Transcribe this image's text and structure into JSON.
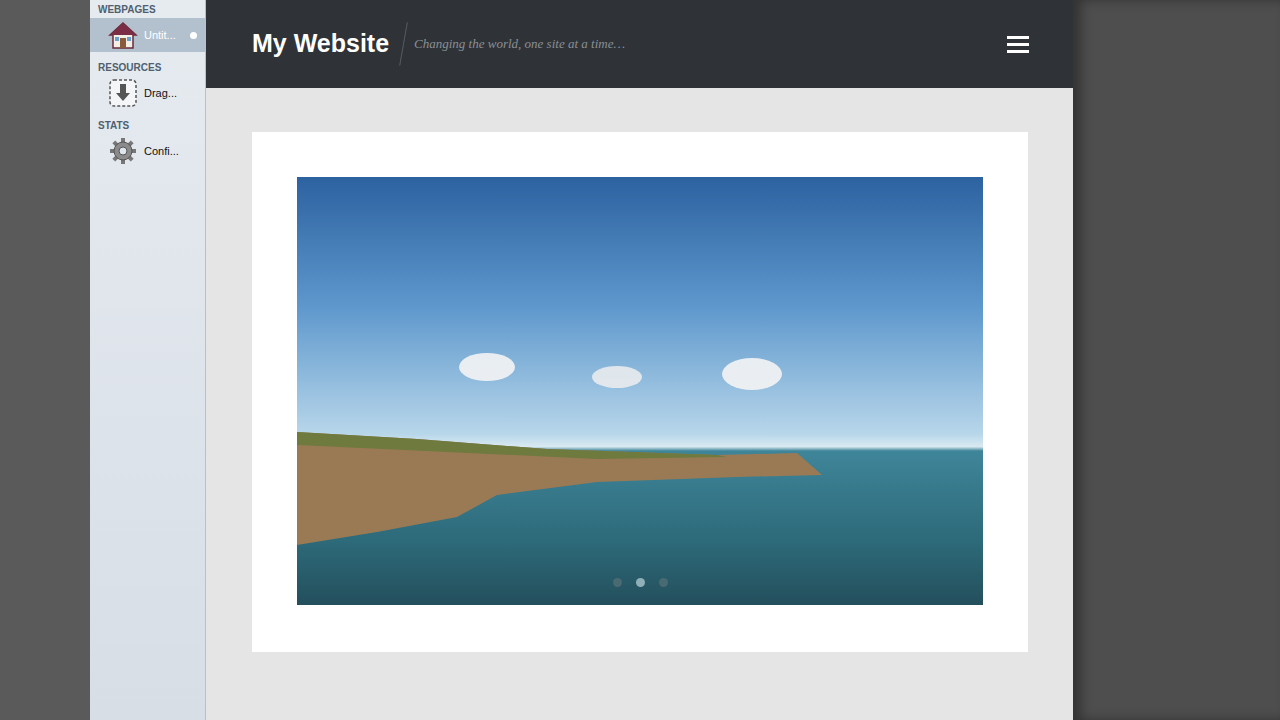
{
  "sidebar": {
    "sections": [
      {
        "label": "WEBPAGES",
        "items": [
          {
            "label": "Untit...",
            "icon": "house",
            "selected": true,
            "modified": true
          }
        ]
      },
      {
        "label": "RESOURCES",
        "items": [
          {
            "label": "Drag...",
            "icon": "drop",
            "selected": false,
            "modified": false
          }
        ]
      },
      {
        "label": "STATS",
        "items": [
          {
            "label": "Confi...",
            "icon": "gear",
            "selected": false,
            "modified": false
          }
        ]
      }
    ]
  },
  "header": {
    "title": "My Website",
    "tagline": "Changing the world, one site at a time…"
  },
  "slideshow": {
    "dots": [
      {
        "selected": false
      },
      {
        "selected": true
      },
      {
        "selected": false
      }
    ]
  }
}
